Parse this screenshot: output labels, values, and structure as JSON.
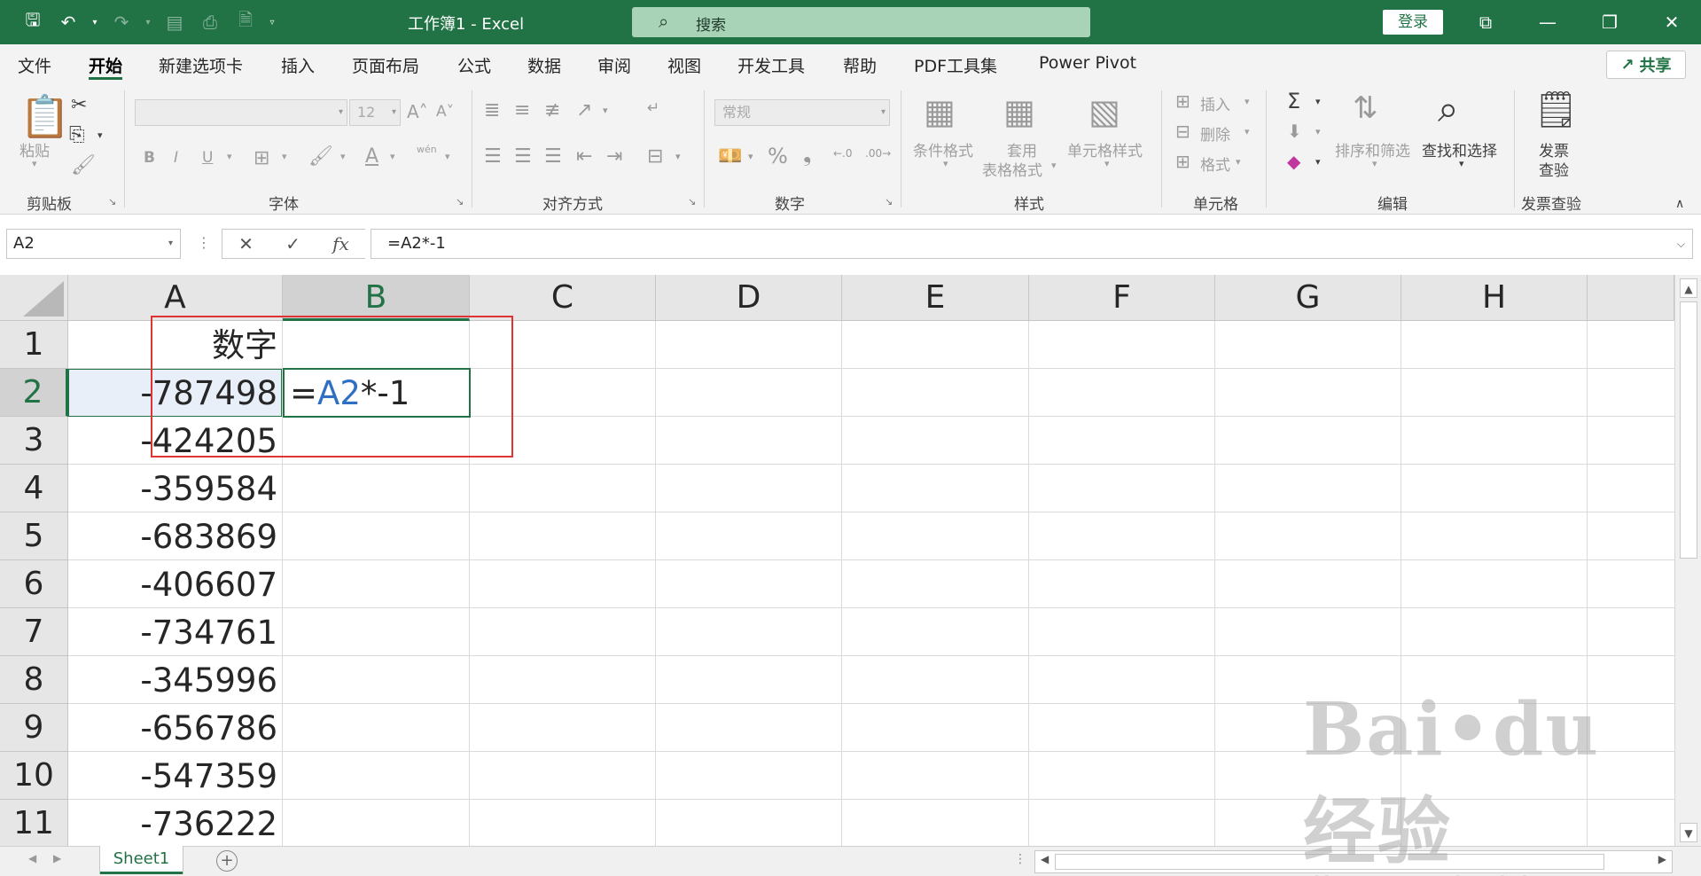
{
  "titlebar": {
    "title": "工作簿1  -  Excel",
    "search_placeholder": "搜索",
    "login_label": "登录"
  },
  "menu_tabs": [
    "文件",
    "开始",
    "新建选项卡",
    "插入",
    "页面布局",
    "公式",
    "数据",
    "审阅",
    "视图",
    "开发工具",
    "帮助",
    "PDF工具集",
    "Power Pivot"
  ],
  "active_tab": "开始",
  "share_label": "共享",
  "ribbon": {
    "clipboard": {
      "paste_label": "粘贴",
      "group_label": "剪贴板"
    },
    "font": {
      "font_name": "",
      "font_size": "12",
      "group_label": "字体",
      "phonetic_label": "wén"
    },
    "alignment": {
      "group_label": "对齐方式"
    },
    "number": {
      "format": "常规",
      "group_label": "数字"
    },
    "styles": {
      "conditional_label": "条件格式",
      "table_label_1": "套用",
      "table_label_2": "表格格式",
      "cell_style_label": "单元格样式",
      "group_label": "样式"
    },
    "cells": {
      "insert_label": "插入",
      "delete_label": "删除",
      "format_label": "格式",
      "group_label": "单元格"
    },
    "editing": {
      "sort_filter_label": "排序和筛选",
      "find_select_label": "查找和选择",
      "group_label": "编辑"
    },
    "invoice": {
      "label_1": "发票",
      "label_2": "查验",
      "group_label": "发票查验"
    }
  },
  "formula_bar": {
    "name_box": "A2",
    "formula": "=A2*-1",
    "fx_label": "fx"
  },
  "sheet": {
    "columns": [
      "A",
      "B",
      "C",
      "D",
      "E",
      "F",
      "G",
      "H"
    ],
    "rows": [
      "1",
      "2",
      "3",
      "4",
      "5",
      "6",
      "7",
      "8",
      "9",
      "10",
      "11"
    ],
    "header_cell": "数字",
    "column_a_values": [
      "-787498",
      "-424205",
      "-359584",
      "-683869",
      "-406607",
      "-734761",
      "-345996",
      "-656786",
      "-547359",
      "-736222"
    ],
    "edit_cell": {
      "prefix": "=",
      "ref": "A2",
      "suffix": "*-1"
    }
  },
  "sheet_tabs": {
    "active": "Sheet1"
  },
  "colors": {
    "excel_green": "#217346",
    "highlight_red": "#e03434",
    "ref_blue": "#2f6fc4"
  }
}
